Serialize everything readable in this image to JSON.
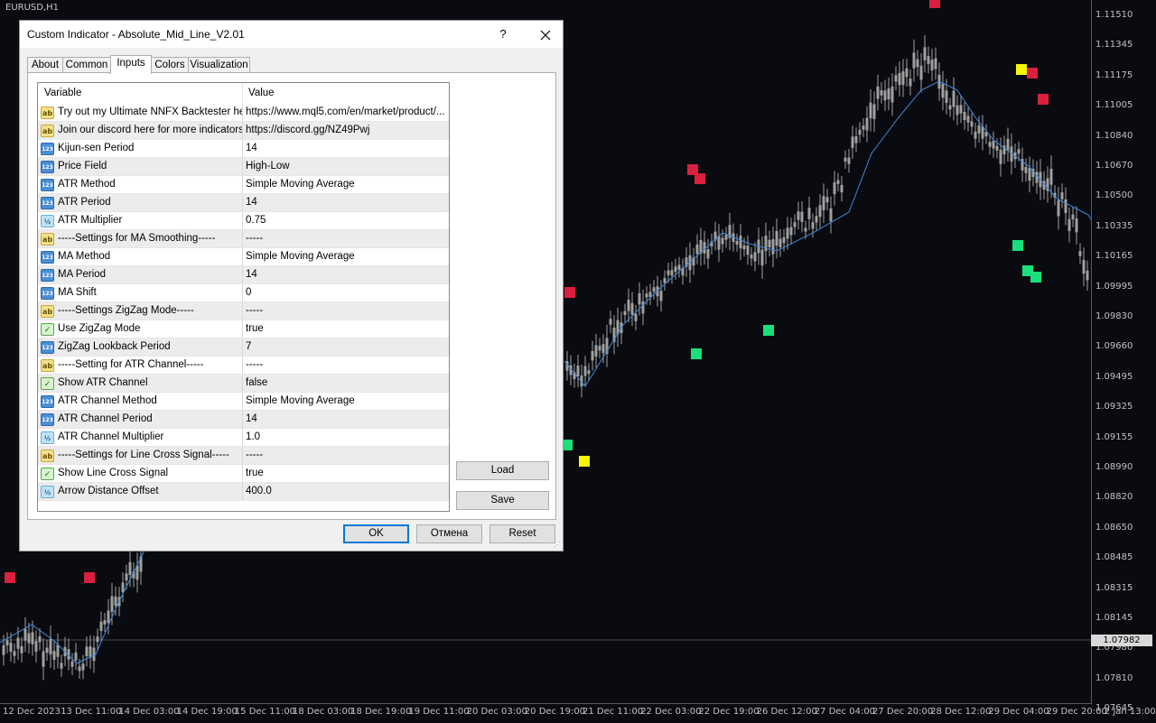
{
  "chart": {
    "symbol": "EURUSD,H1",
    "price_labels": [
      "1.11510",
      "1.11345",
      "1.11175",
      "1.11005",
      "1.10840",
      "1.10670",
      "1.10500",
      "1.10335",
      "1.10165",
      "1.09995",
      "1.09830",
      "1.09660",
      "1.09495",
      "1.09325",
      "1.09155",
      "1.08990",
      "1.08820",
      "1.08650",
      "1.08485",
      "1.08315",
      "1.08145",
      "1.07980",
      "1.07810",
      "1.07645"
    ],
    "current_price": "1.07982",
    "time_labels": [
      "12 Dec 2023",
      "13 Dec 11:00",
      "14 Dec 03:00",
      "14 Dec 19:00",
      "15 Dec 11:00",
      "18 Dec 03:00",
      "18 Dec 19:00",
      "19 Dec 11:00",
      "20 Dec 03:00",
      "20 Dec 19:00",
      "21 Dec 11:00",
      "22 Dec 03:00",
      "22 Dec 19:00",
      "26 Dec 12:00",
      "27 Dec 04:00",
      "27 Dec 20:00",
      "28 Dec 12:00",
      "29 Dec 04:00",
      "29 Dec 20:00",
      "2 Jan 13:00"
    ],
    "colors": {
      "background": "#0a0b10",
      "mid_line": "#3d8be0",
      "candle": "#a0a0a0",
      "buy": "#19e07a",
      "sell": "#d9203f",
      "signal": "#f5f50a"
    }
  },
  "dialog": {
    "title": "Custom Indicator - Absolute_Mid_Line_V2.01",
    "help_label": "?",
    "close_icon": "close-icon",
    "tabs": [
      {
        "label": "About"
      },
      {
        "label": "Common"
      },
      {
        "label": "Inputs",
        "active": true
      },
      {
        "label": "Colors"
      },
      {
        "label": "Visualization"
      }
    ],
    "grid": {
      "col_variable": "Variable",
      "col_value": "Value",
      "rows": [
        {
          "type": "str",
          "icon_text": "ab",
          "name": "Try out my Ultimate NNFX Backtester here",
          "value": "https://www.mql5.com/en/market/product/..."
        },
        {
          "type": "str",
          "icon_text": "ab",
          "name": "Join our discord here for more indicators",
          "value": "https://discord.gg/NZ49Pwj"
        },
        {
          "type": "int",
          "icon_text": "123",
          "name": "Kijun-sen Period",
          "value": "14"
        },
        {
          "type": "int",
          "icon_text": "123",
          "name": "Price Field",
          "value": "High-Low"
        },
        {
          "type": "int",
          "icon_text": "123",
          "name": "ATR Method",
          "value": "Simple Moving Average"
        },
        {
          "type": "int",
          "icon_text": "123",
          "name": "ATR Period",
          "value": "14"
        },
        {
          "type": "dbl",
          "icon_text": "½",
          "name": "ATR Multiplier",
          "value": "0.75"
        },
        {
          "type": "str",
          "icon_text": "ab",
          "name": "-----Settings for MA Smoothing-----",
          "value": "-----"
        },
        {
          "type": "int",
          "icon_text": "123",
          "name": "MA Method",
          "value": "Simple Moving Average"
        },
        {
          "type": "int",
          "icon_text": "123",
          "name": "MA Period",
          "value": "14"
        },
        {
          "type": "int",
          "icon_text": "123",
          "name": "MA Shift",
          "value": "0"
        },
        {
          "type": "str",
          "icon_text": "ab",
          "name": "-----Settings ZigZag Mode-----",
          "value": "-----"
        },
        {
          "type": "bool",
          "icon_text": "✓",
          "name": "Use ZigZag Mode",
          "value": "true"
        },
        {
          "type": "int",
          "icon_text": "123",
          "name": "ZigZag Lookback Period",
          "value": "7"
        },
        {
          "type": "str",
          "icon_text": "ab",
          "name": "-----Setting for ATR Channel-----",
          "value": "-----"
        },
        {
          "type": "bool",
          "icon_text": "✓",
          "name": "Show ATR Channel",
          "value": "false"
        },
        {
          "type": "int",
          "icon_text": "123",
          "name": "ATR Channel Method",
          "value": "Simple Moving Average"
        },
        {
          "type": "int",
          "icon_text": "123",
          "name": "ATR Channel Period",
          "value": "14"
        },
        {
          "type": "dbl",
          "icon_text": "½",
          "name": "ATR Channel Multiplier",
          "value": "1.0"
        },
        {
          "type": "str",
          "icon_text": "ab",
          "name": "-----Settings for Line Cross Signal-----",
          "value": "-----"
        },
        {
          "type": "bool",
          "icon_text": "✓",
          "name": "Show Line Cross Signal",
          "value": "true"
        },
        {
          "type": "dbl",
          "icon_text": "½",
          "name": "Arrow Distance Offset",
          "value": "400.0"
        }
      ]
    },
    "buttons": {
      "load": "Load",
      "save": "Save",
      "ok": "OK",
      "cancel": "Отмена",
      "reset": "Reset"
    }
  }
}
